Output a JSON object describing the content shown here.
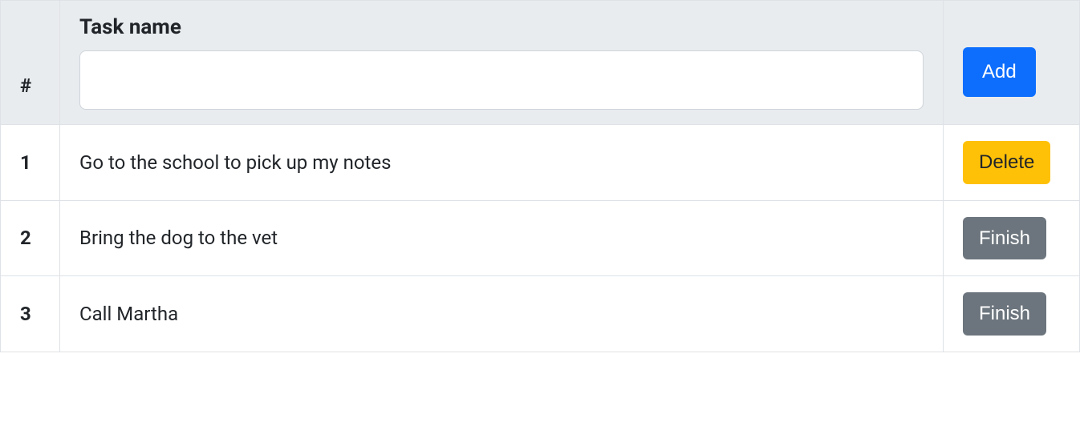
{
  "header": {
    "index_label": "#",
    "task_label": "Task name",
    "input_value": "",
    "add_button_label": "Add"
  },
  "rows": [
    {
      "index": "1",
      "name": "Go to the school to pick up my notes",
      "action_label": "Delete",
      "action_type": "delete"
    },
    {
      "index": "2",
      "name": "Bring the dog to the vet",
      "action_label": "Finish",
      "action_type": "finish"
    },
    {
      "index": "3",
      "name": "Call Martha",
      "action_label": "Finish",
      "action_type": "finish"
    }
  ],
  "button_classes": {
    "delete": "btn-warning",
    "finish": "btn-secondary"
  }
}
